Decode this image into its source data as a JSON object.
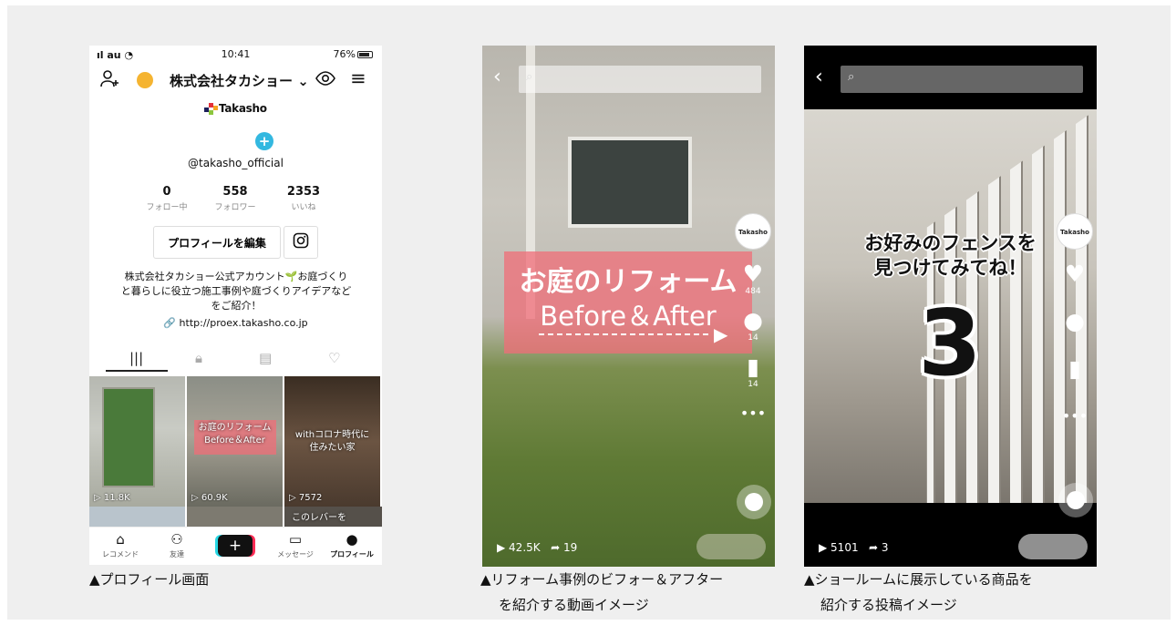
{
  "profile_phone": {
    "status": {
      "carrier": "au",
      "time": "10:41",
      "battery": "76%"
    },
    "account_name": "株式会社タカショー",
    "logo_text": "Takasho",
    "handle": "@takasho_official",
    "stats": [
      {
        "value": "0",
        "label": "フォロー中"
      },
      {
        "value": "558",
        "label": "フォロワー"
      },
      {
        "value": "2353",
        "label": "いいね"
      }
    ],
    "edit_profile_label": "プロフィールを編集",
    "bio": "株式会社タカショー公式アカウント🌱お庭づくりと暮らしに役立つ施工事例や庭づくりアイデアなどをご紹介！",
    "link": "http://proex.takasho.co.jp",
    "tiles": [
      {
        "views": "11.8K",
        "caption": ""
      },
      {
        "views": "60.9K",
        "caption": "お庭のリフォーム\nBefore＆After"
      },
      {
        "views": "7572",
        "caption": "withコロナ時代に\n住みたい家"
      }
    ],
    "strip_caption": "このレバーを",
    "nav": {
      "recommend": "レコメンド",
      "friends": "友達",
      "messages": "メッセージ",
      "profile": "プロフィール"
    }
  },
  "video_reform": {
    "overlay_title": "お庭のリフォーム",
    "overlay_subtitle": "Before＆After",
    "avatar_text": "Takasho",
    "likes": "484",
    "comments": "14",
    "saves": "14",
    "views": "42.5K",
    "shares": "19"
  },
  "video_showroom": {
    "overlay_line1": "お好みのフェンスを",
    "overlay_line2": "見つけてみてね！",
    "big_number": "3",
    "avatar_text": "Takasho",
    "views": "5101",
    "shares": "3"
  },
  "captions": {
    "profile": "▲プロフィール画面",
    "reform_line1": "▲リフォーム事例のビフォー＆アフター",
    "reform_line2": "を紹介する動画イメージ",
    "showroom_line1": "▲ショールームに展示している商品を",
    "showroom_line2": "紹介する投稿イメージ"
  },
  "colors": {
    "page_bg": "#efefef",
    "badge_blue": "#33b8e0",
    "overlay_pink": "#f06e78",
    "account_dot": "#f5b431"
  }
}
